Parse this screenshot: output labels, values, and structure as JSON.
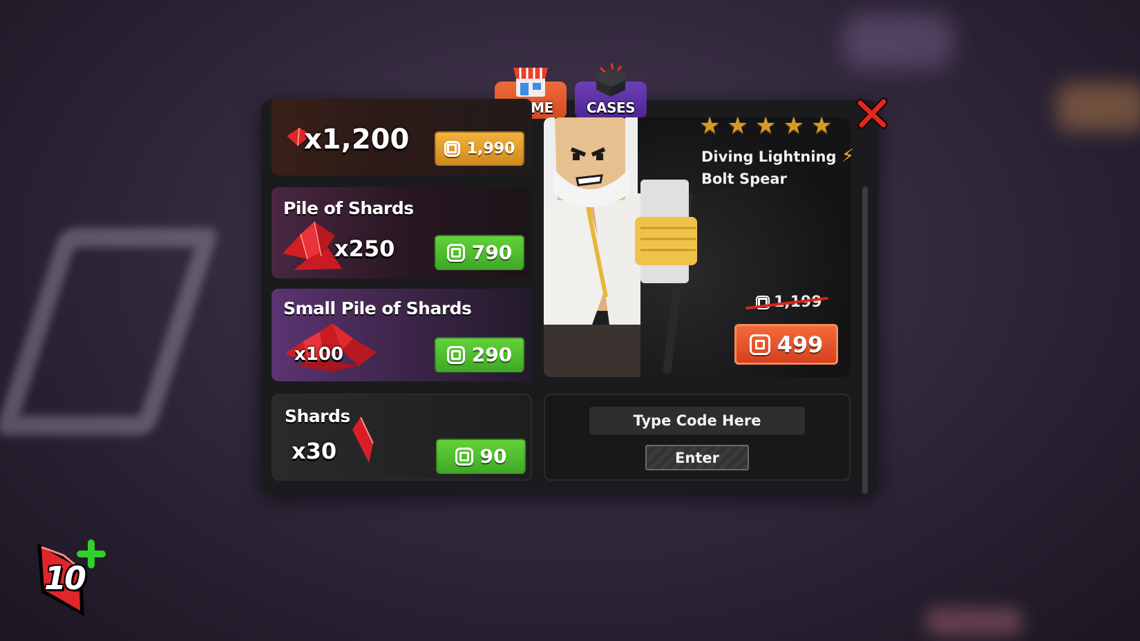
{
  "tabs": [
    {
      "label": "HOME",
      "icon": "shop-icon"
    },
    {
      "label": "CASES",
      "icon": "chest-icon"
    }
  ],
  "bundles": [
    {
      "title": "",
      "quantity": "x1,200",
      "price": "1,990",
      "button_color": "#e0a02c"
    },
    {
      "title": "Pile of Shards",
      "quantity": "x250",
      "price": "790",
      "button_color": "#4fbd2d"
    },
    {
      "title": "Small Pile of Shards",
      "quantity": "x100",
      "price": "290",
      "button_color": "#4fbd2d"
    },
    {
      "title": "Shards",
      "quantity": "x30",
      "price": "90",
      "button_color": "#4fbd2d"
    }
  ],
  "featured": {
    "stars": 5,
    "name_line1": "Diving Lightning",
    "name_line2": "Bolt Spear",
    "old_price": "1,199",
    "price": "499",
    "button_color": "#e2522a"
  },
  "code": {
    "placeholder": "Type Code Here",
    "enter_label": "Enter"
  },
  "hud": {
    "shard_count": "10"
  }
}
